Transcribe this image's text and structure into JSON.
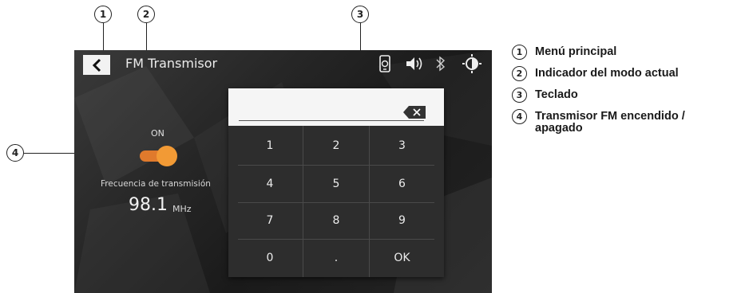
{
  "screen": {
    "title": "FM Transmisor",
    "toggle_label": "ON",
    "toggle_on": true,
    "frequency_label": "Frecuencia de transmisión",
    "frequency_value": "98.1",
    "frequency_unit": "MHz",
    "status_icons": [
      "phone-sync-icon",
      "volume-icon",
      "bluetooth-icon",
      "brightness-icon"
    ],
    "accent_color": "#f29a35"
  },
  "keypad": {
    "input_value": "",
    "backspace_icon": "backspace-icon",
    "keys": [
      "1",
      "2",
      "3",
      "4",
      "5",
      "6",
      "7",
      "8",
      "9",
      "0",
      ".",
      "OK"
    ]
  },
  "callouts": {
    "c1": "1",
    "c2": "2",
    "c3": "3",
    "c4": "4"
  },
  "legend": [
    {
      "num": "1",
      "text": "Menú principal"
    },
    {
      "num": "2",
      "text": "Indicador del modo actual"
    },
    {
      "num": "3",
      "text": "Teclado"
    },
    {
      "num": "4",
      "text": "Transmisor FM encendido / apagado"
    }
  ]
}
